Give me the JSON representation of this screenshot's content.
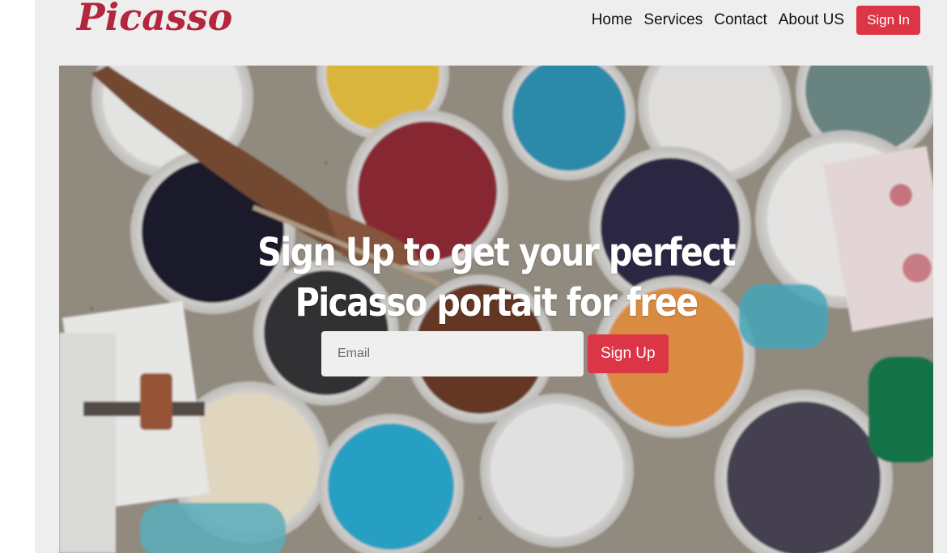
{
  "brand": {
    "name": "Picasso",
    "color": "#b3263d"
  },
  "nav": {
    "items": [
      "Home",
      "Services",
      "Contact",
      "About US"
    ],
    "signin_label": "Sign In"
  },
  "hero": {
    "headline_line1": "Sign Up to get your perfect",
    "headline_line2": "Picasso portait for free",
    "email_placeholder": "Email",
    "signup_label": "Sign Up",
    "image_subject": "paint buckets with hand holding brush"
  },
  "colors": {
    "accent": "#dc3545",
    "page_bg": "#eeeeee"
  }
}
